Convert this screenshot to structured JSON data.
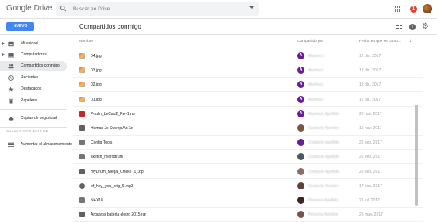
{
  "app": {
    "logo_google": "Google",
    "logo_drive": "Drive",
    "notifications_count": "1"
  },
  "search": {
    "placeholder": "Buscar en Drive"
  },
  "toolbar": {
    "new_label": "NUEVO",
    "page_title": "Compartidos conmigo"
  },
  "sidebar": {
    "items": [
      {
        "label": "Mi unidad",
        "icon": "drive-icon",
        "expandable": true
      },
      {
        "label": "Computadoras",
        "icon": "computer-icon",
        "expandable": true
      },
      {
        "label": "Compartidos conmigo",
        "icon": "people-icon",
        "active": true
      },
      {
        "label": "Recientes",
        "icon": "clock-icon"
      },
      {
        "label": "Destacados",
        "icon": "star-icon"
      },
      {
        "label": "Papelera",
        "icon": "trash-icon"
      },
      {
        "label": "Copias de seguridad",
        "icon": "cloud-icon"
      }
    ],
    "storage_text": "Se usó 5.2 GB de 15 GB",
    "storage_link": "Aumentar el almacenamiento"
  },
  "table": {
    "headers": {
      "name": "Nombre",
      "shared_by": "Compartido por",
      "date": "Fecha en que se comp..."
    },
    "rows": [
      {
        "name": "04.jpg",
        "type": "image",
        "owner_initial": "A",
        "owner": "Alumno1",
        "date": "12 dic. 2017"
      },
      {
        "name": "03.jpg",
        "type": "image",
        "owner_initial": "A",
        "owner": "Alumno1",
        "date": "12 dic. 2017"
      },
      {
        "name": "02.jpg",
        "type": "image",
        "owner_initial": "A",
        "owner": "Alumno1",
        "date": "12 dic. 2017"
      },
      {
        "name": "01.jpg",
        "type": "image",
        "owner_initial": "A",
        "owner": "Alumno1",
        "date": "12 dic. 2017"
      },
      {
        "name": "Poulin_LeCab2_Rev1.rar",
        "type": "archive-red",
        "owner_initial": "A",
        "owner": "Alumno2 Apellido",
        "date": "20 nov. 2017"
      },
      {
        "name": "Human Jx Sweep Air.7z",
        "type": "archive",
        "owner_initial": "",
        "owner": "Contacto Nombre",
        "date": "15 nov. 2017"
      },
      {
        "name": "Config Tools",
        "type": "folder",
        "owner_initial": "",
        "owner": "Contacto Apellido",
        "date": "26 sep. 2017"
      },
      {
        "name": "sketch_microdrum",
        "type": "folder",
        "owner_initial": "",
        "owner": "Contacto Apellido",
        "date": "26 sep. 2017"
      },
      {
        "name": "myDrum_Mega_Choke (1).zip",
        "type": "archive",
        "owner_initial": "",
        "owner": "Contacto Apellido",
        "date": "26 sep. 2017"
      },
      {
        "name": "pf_hey_you_orig_6.mp3",
        "type": "audio",
        "owner_initial": "",
        "owner": "Contacto Nombre",
        "date": "17 sep. 2017"
      },
      {
        "name": "NAX18",
        "type": "folder",
        "owner_initial": "",
        "owner": "Persona Apellido",
        "date": "26 jul. 2017"
      },
      {
        "name": "Arquivos bateria eletro 2015.rar",
        "type": "archive",
        "owner_initial": "",
        "owner": "Persona Nombre",
        "date": "26 may. 2017"
      }
    ]
  },
  "colors": {
    "accent": "#4285f4",
    "owner_a": "#6a1b9a",
    "active_nav": "#e8eaed"
  }
}
